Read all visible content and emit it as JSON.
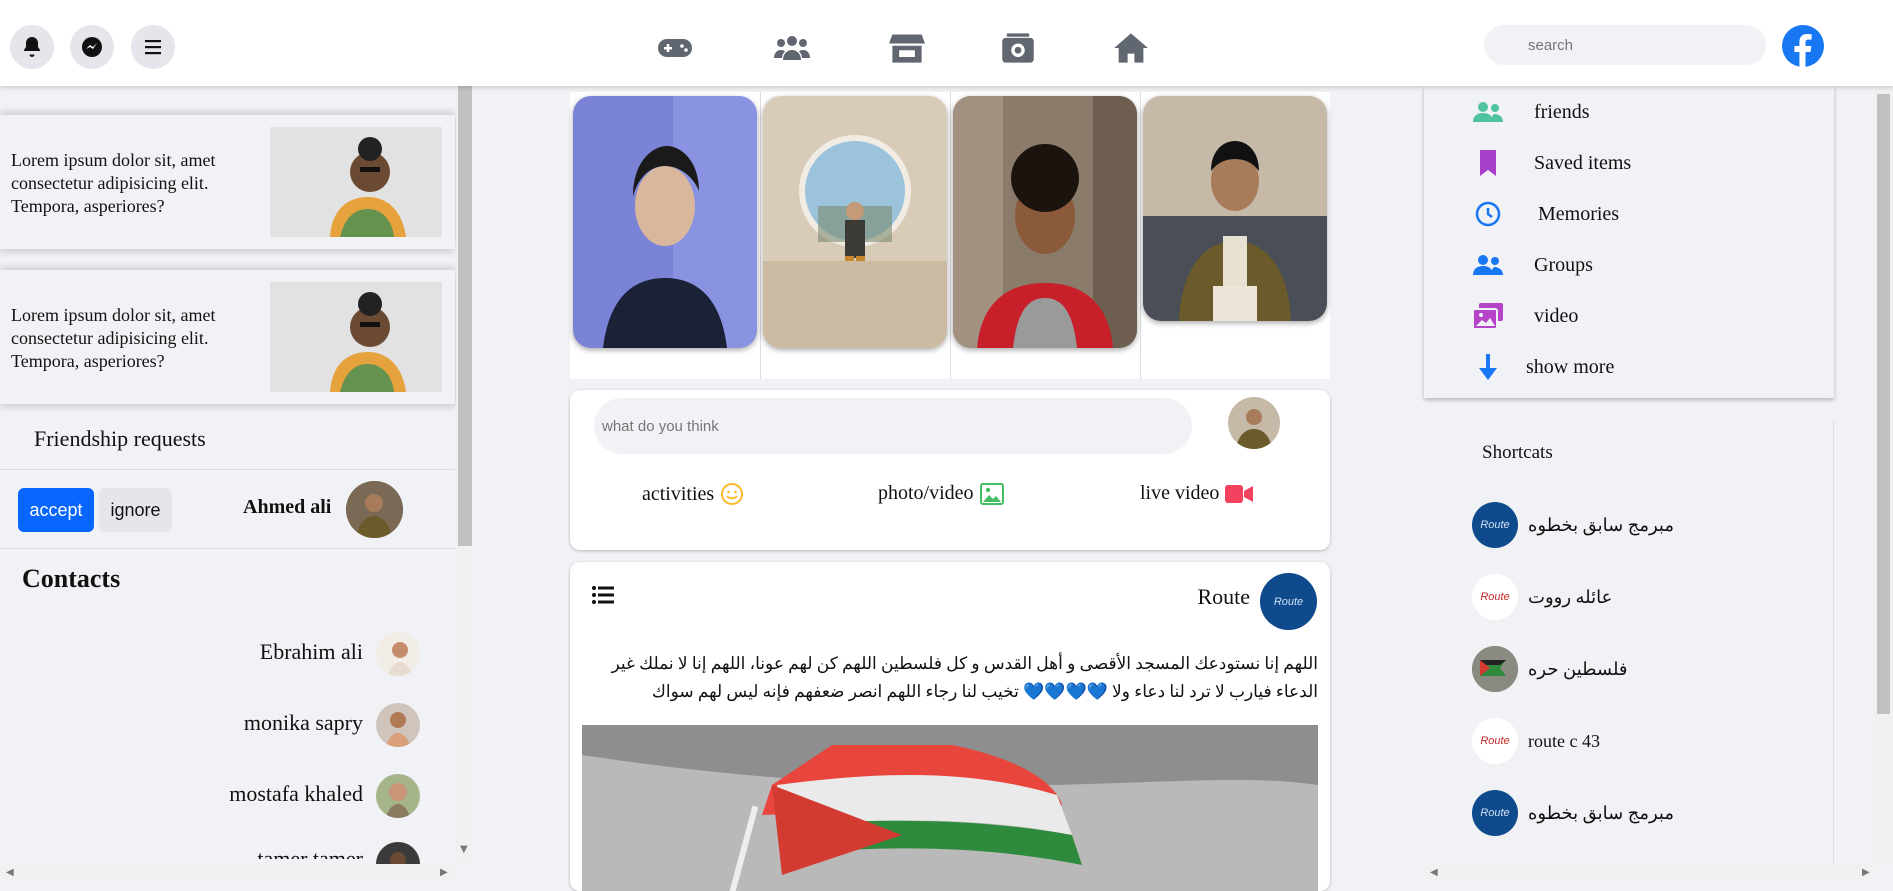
{
  "header": {
    "left_buttons": [
      "bell-icon",
      "messenger-icon",
      "menu-icon"
    ],
    "center_icons": [
      "gaming-icon",
      "people-icon",
      "store-icon",
      "watch-icon",
      "home-icon"
    ],
    "search_placeholder": "search",
    "brand_color": "#1877f2"
  },
  "left_sidebar": {
    "story_cards": [
      {
        "text": "Lorem ipsum dolor sit, amet consectetur adipisicing elit. Tempora, asperiores?"
      },
      {
        "text": "Lorem ipsum dolor sit, amet consectetur adipisicing elit. Tempora, asperiores?"
      }
    ],
    "friend_requests": {
      "title": "Friendship requests",
      "accept_label": "accept",
      "ignore_label": "ignore",
      "name": "Ahmed ali"
    },
    "contacts": {
      "title": "Contacts",
      "items": [
        {
          "name": "Ebrahim ali"
        },
        {
          "name": "monika sapry"
        },
        {
          "name": "mostafa khaled"
        },
        {
          "name": "tamer tamer"
        }
      ]
    }
  },
  "composer": {
    "placeholder": "what do you think",
    "actions": [
      {
        "label": "activities",
        "icon": "smile-icon",
        "color": "#f7b928"
      },
      {
        "label": "photo/video",
        "icon": "image-icon",
        "color": "#45bd62"
      },
      {
        "label": "live video",
        "icon": "video-icon",
        "color": "#f3425f"
      }
    ]
  },
  "post": {
    "author": "Route",
    "text": "اللهم إنا نستودعك المسجد الأقصى و أهل القدس و كل فلسطين اللهم كن لهم عونا، اللهم إنا لا نملك غير الدعاء فيارب لا ترد لنا دعاء ولا 💙💙💙💙 تخيب لنا رجاء اللهم انصر ضعفهم فإنه ليس لهم سواك"
  },
  "right_sidebar": {
    "menu": [
      {
        "label": "friends",
        "icon": "friends-icon",
        "color": "#4fc3a1"
      },
      {
        "label": "Saved items",
        "icon": "bookmark-icon",
        "color": "#a83fc8"
      },
      {
        "label": "Memories",
        "icon": "clock-icon",
        "color": "#1877f2"
      },
      {
        "label": "Groups",
        "icon": "groups-icon",
        "color": "#1877f2"
      },
      {
        "label": "video",
        "icon": "video-gallery-icon",
        "color": "#b544c9"
      },
      {
        "label": "show more",
        "icon": "arrow-down-icon",
        "color": "#1877f2"
      }
    ],
    "shortcuts": {
      "title": "Shortcats",
      "items": [
        {
          "name": "مبرمج سابق بخطوه",
          "logo_text": "Route"
        },
        {
          "name": "عائله رووت",
          "logo_text": "Route"
        },
        {
          "name": "فلسطين حره",
          "logo_text": ""
        },
        {
          "name": "route c 43",
          "logo_text": "Route"
        },
        {
          "name": "مبرمج سابق بخطوه",
          "logo_text": "Route"
        }
      ]
    }
  }
}
